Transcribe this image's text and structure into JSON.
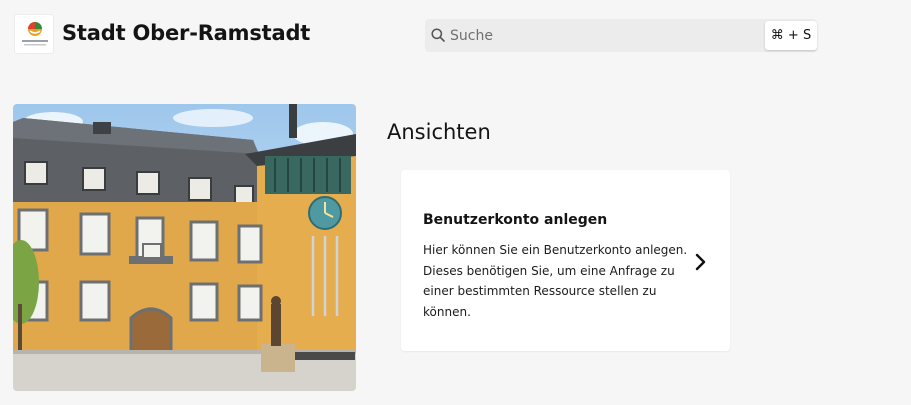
{
  "header": {
    "title": "Stadt Ober-Ramstadt",
    "logo_icon": "city-logo-icon"
  },
  "search": {
    "placeholder": "Suche",
    "shortcut": "⌘ + S"
  },
  "hero": {
    "icon": "town-hall-photo"
  },
  "main": {
    "heading": "Ansichten",
    "cards": [
      {
        "title": "Benutzerkonto anlegen",
        "description": "Hier können Sie ein Benutzerkonto anlegen. Dieses benötigen Sie, um eine Anfrage zu einer bestimmten Ressource stellen zu können.",
        "icon": "chevron-right-icon"
      }
    ]
  }
}
